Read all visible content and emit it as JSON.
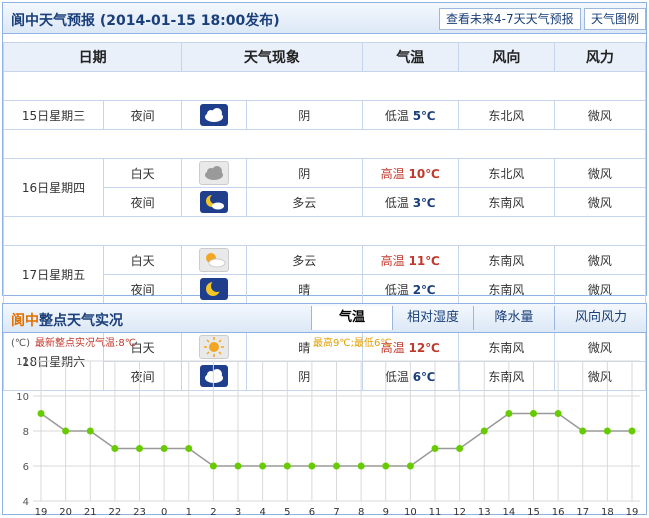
{
  "forecast": {
    "title": "阆中天气预报 (2014-01-15  18:00发布)",
    "btn_future": "查看未来4-7天天气预报",
    "btn_legend": "天气图例",
    "headers": [
      "日期",
      "天气现象",
      "气温",
      "风向",
      "风力"
    ],
    "rows": [
      {
        "date": "15日星期三",
        "period": "夜间",
        "icon": "cloudy-night-icon",
        "cond": "阴",
        "temp_label": "低温",
        "temp": "5℃",
        "wind_dir": "东北风",
        "wind_force": "微风"
      },
      {
        "date": "16日星期四",
        "period": "白天",
        "icon": "cloudy-day-icon",
        "cond": "阴",
        "temp_label": "高温",
        "temp": "10℃",
        "wind_dir": "东北风",
        "wind_force": "微风"
      },
      {
        "date": "",
        "period": "夜间",
        "icon": "moon-cloud-icon",
        "cond": "多云",
        "temp_label": "低温",
        "temp": "3℃",
        "wind_dir": "东南风",
        "wind_force": "微风"
      },
      {
        "date": "17日星期五",
        "period": "白天",
        "icon": "sun-cloud-icon",
        "cond": "多云",
        "temp_label": "高温",
        "temp": "11℃",
        "wind_dir": "东南风",
        "wind_force": "微风"
      },
      {
        "date": "",
        "period": "夜间",
        "icon": "moon-icon",
        "cond": "晴",
        "temp_label": "低温",
        "temp": "2℃",
        "wind_dir": "东南风",
        "wind_force": "微风"
      },
      {
        "date": "18日星期六",
        "period": "白天",
        "icon": "sun-icon",
        "cond": "晴",
        "temp_label": "高温",
        "temp": "12℃",
        "wind_dir": "东南风",
        "wind_force": "微风"
      },
      {
        "date": "",
        "period": "夜间",
        "icon": "cloudy-night-icon",
        "cond": "阴",
        "temp_label": "低温",
        "temp": "6℃",
        "wind_dir": "东南风",
        "wind_force": "微风"
      }
    ]
  },
  "hourly": {
    "city": "阆中",
    "title": "整点天气实况",
    "tabs": [
      "气温",
      "相对湿度",
      "降水量",
      "风向风力"
    ],
    "active_tab": "气温"
  },
  "chart_data": {
    "type": "line",
    "unit_label": "(℃)",
    "latest_label": "最新整点实况气温:8℃",
    "range_label": "最高9℃;最低6℃",
    "categories": [
      "19",
      "20",
      "21",
      "22",
      "23",
      "0",
      "1",
      "2",
      "3",
      "4",
      "5",
      "6",
      "7",
      "8",
      "9",
      "10",
      "11",
      "12",
      "13",
      "14",
      "15",
      "16",
      "17",
      "18",
      "19"
    ],
    "values": [
      9,
      8,
      8,
      7,
      7,
      7,
      7,
      6,
      6,
      6,
      6,
      6,
      6,
      6,
      6,
      6,
      7,
      7,
      8,
      9,
      9,
      9,
      8,
      8,
      8
    ],
    "ylim": [
      4,
      12
    ],
    "yticks": [
      4,
      6,
      8,
      10,
      12
    ],
    "grid": true,
    "colors": {
      "line": "#999999",
      "point": "#66cc00",
      "grid": "#d9d9d9"
    }
  }
}
